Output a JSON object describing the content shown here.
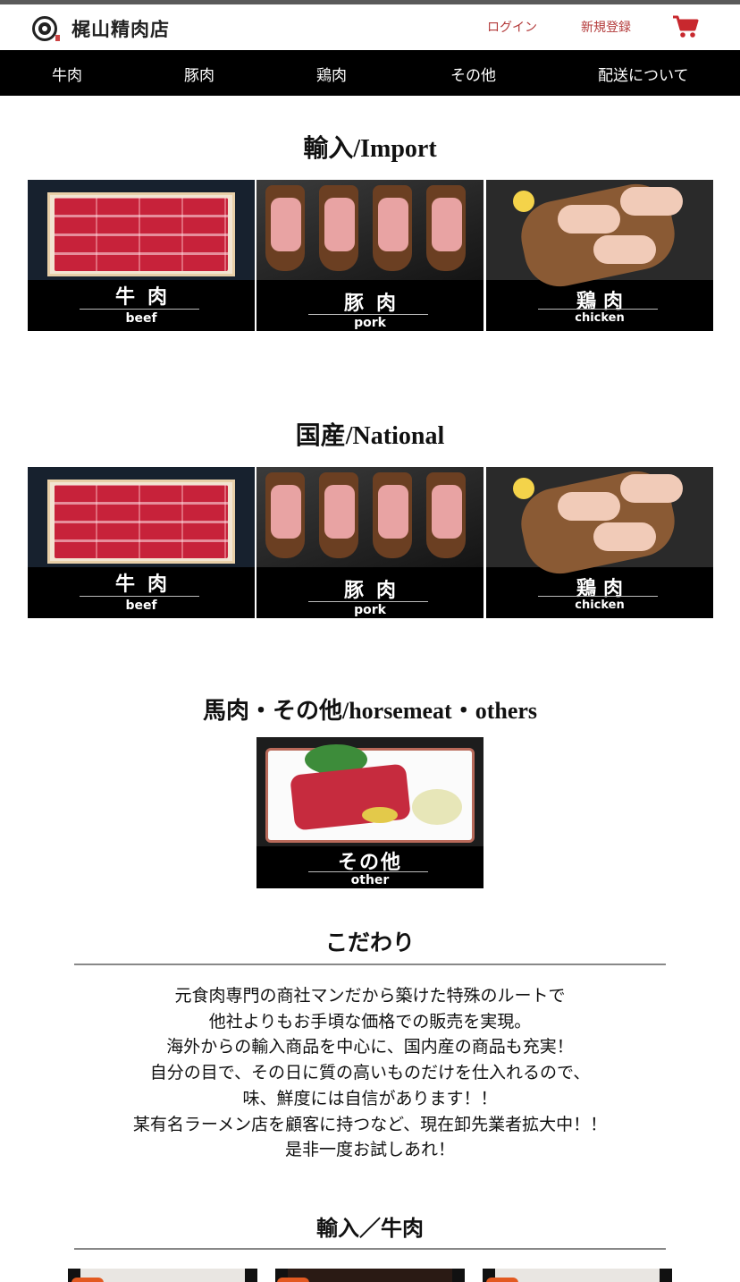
{
  "header": {
    "logo_text": "梶山精肉店",
    "login_label": "ログイン",
    "register_label": "新規登録",
    "cart_icon": "cart-icon",
    "accent_color": "#b33a3a"
  },
  "nav": {
    "items": [
      {
        "label": "牛肉"
      },
      {
        "label": "豚肉"
      },
      {
        "label": "鶏肉"
      },
      {
        "label": "その他"
      },
      {
        "label": "配送について"
      }
    ]
  },
  "import_section": {
    "title": "輸入/Import",
    "tiles": [
      {
        "jp": "牛肉",
        "en": "beef"
      },
      {
        "jp": "豚肉",
        "en": "pork"
      },
      {
        "jp": "鶏肉",
        "en": "chicken"
      }
    ]
  },
  "national_section": {
    "title": "国産/National",
    "tiles": [
      {
        "jp": "牛肉",
        "en": "beef"
      },
      {
        "jp": "豚肉",
        "en": "pork"
      },
      {
        "jp": "鶏肉",
        "en": "chicken"
      }
    ]
  },
  "other_section": {
    "title": "馬肉・その他/horsemeat・others",
    "tile": {
      "jp": "その他",
      "en": "other"
    }
  },
  "kodawari": {
    "title": "こだわり",
    "lines": [
      "元食肉専門の商社マンだから築けた特殊のルートで",
      "他社よりもお手頃な価格での販売を実現。",
      "海外からの輸入商品を中心に、国内産の商品も充実！",
      "自分の目で、その日に質の高いものだけを仕入れるので、",
      "味、鮮度には自信があります！！",
      "某有名ラーメン店を顧客に持つなど、現在卸先業者拡大中！！",
      "是非一度お試しあれ！"
    ]
  },
  "import_beef_section": {
    "title": "輸入／牛肉"
  }
}
